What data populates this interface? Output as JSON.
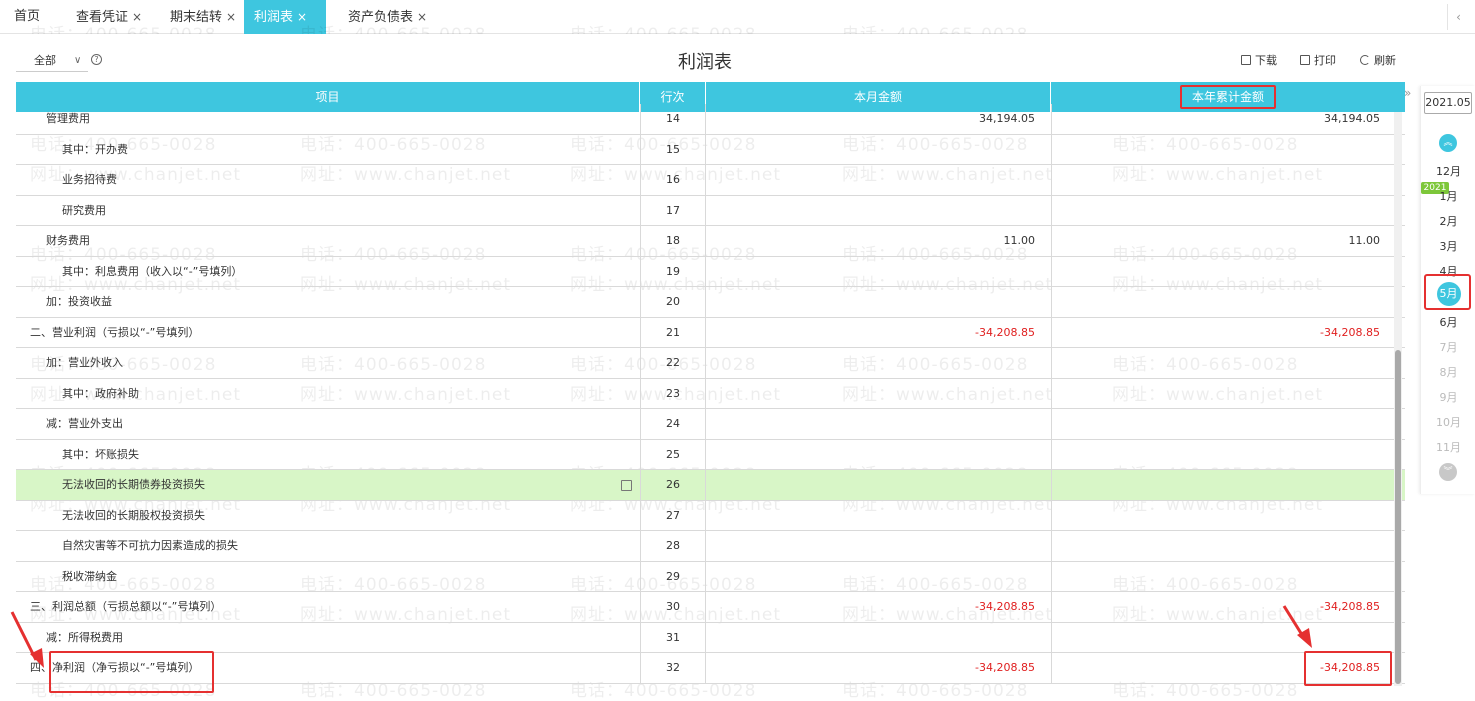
{
  "tabs": [
    {
      "label": "首页",
      "closable": false,
      "active": false
    },
    {
      "label": "查看凭证",
      "closable": true,
      "active": false
    },
    {
      "label": "期末结转",
      "closable": true,
      "active": false
    },
    {
      "label": "利润表",
      "closable": true,
      "active": true
    },
    {
      "label": "资产负债表",
      "closable": true,
      "active": false
    }
  ],
  "close_glyph": "×",
  "toolbar": {
    "filter_value": "全部",
    "title": "利润表",
    "download_label": "下载",
    "print_label": "打印",
    "refresh_label": "刷新"
  },
  "table": {
    "headers": [
      "项目",
      "行次",
      "本月金额",
      "本年累计金额"
    ],
    "rows": [
      {
        "name": "管理费用",
        "line": "14",
        "month": "34,194.05",
        "year": "34,194.05"
      },
      {
        "name": "其中：开办费",
        "line": "15",
        "month": "",
        "year": ""
      },
      {
        "name": "业务招待费",
        "line": "16",
        "month": "",
        "year": ""
      },
      {
        "name": "研究费用",
        "line": "17",
        "month": "",
        "year": ""
      },
      {
        "name": "财务费用",
        "line": "18",
        "month": "11.00",
        "year": "11.00"
      },
      {
        "name": "其中：利息费用（收入以“-”号填列）",
        "line": "19",
        "month": "",
        "year": ""
      },
      {
        "name": "加：投资收益",
        "line": "20",
        "month": "",
        "year": ""
      },
      {
        "name": "二、营业利润（亏损以“-”号填列）",
        "line": "21",
        "month": "-34,208.85",
        "year": "-34,208.85"
      },
      {
        "name": "加：营业外收入",
        "line": "22",
        "month": "",
        "year": ""
      },
      {
        "name": "其中：政府补助",
        "line": "23",
        "month": "",
        "year": ""
      },
      {
        "name": "减：营业外支出",
        "line": "24",
        "month": "",
        "year": ""
      },
      {
        "name": "其中：坏账损失",
        "line": "25",
        "month": "",
        "year": ""
      },
      {
        "name": "无法收回的长期债券投资损失",
        "line": "26",
        "month": "",
        "year": ""
      },
      {
        "name": "无法收回的长期股权投资损失",
        "line": "27",
        "month": "",
        "year": ""
      },
      {
        "name": "自然灾害等不可抗力因素造成的损失",
        "line": "28",
        "month": "",
        "year": ""
      },
      {
        "name": "税收滞纳金",
        "line": "29",
        "month": "",
        "year": ""
      },
      {
        "name": "三、利润总额（亏损总额以“-”号填列）",
        "line": "30",
        "month": "-34,208.85",
        "year": "-34,208.85"
      },
      {
        "name": "减：所得税费用",
        "line": "31",
        "month": "",
        "year": ""
      },
      {
        "name": "四、净利润（净亏损以“-”号填列）",
        "line": "32",
        "month": "-34,208.85",
        "year": "-34,208.85"
      }
    ]
  },
  "period": {
    "current": "2021.05",
    "year_badge": "2021",
    "months": [
      "12月",
      "1月",
      "2月",
      "3月",
      "4月",
      "5月",
      "6月",
      "7月",
      "8月",
      "9月",
      "10月",
      "11月"
    ],
    "selected_month": "5月"
  },
  "watermark": {
    "phone": "电话：400-665-0028",
    "site": "网址：www.chanjet.net"
  },
  "colors": {
    "accent": "#3ec6df",
    "negative": "#e02020",
    "highlight_row": "#d8f6c7",
    "annotation": "#e53030",
    "year_badge": "#7dc73a"
  }
}
